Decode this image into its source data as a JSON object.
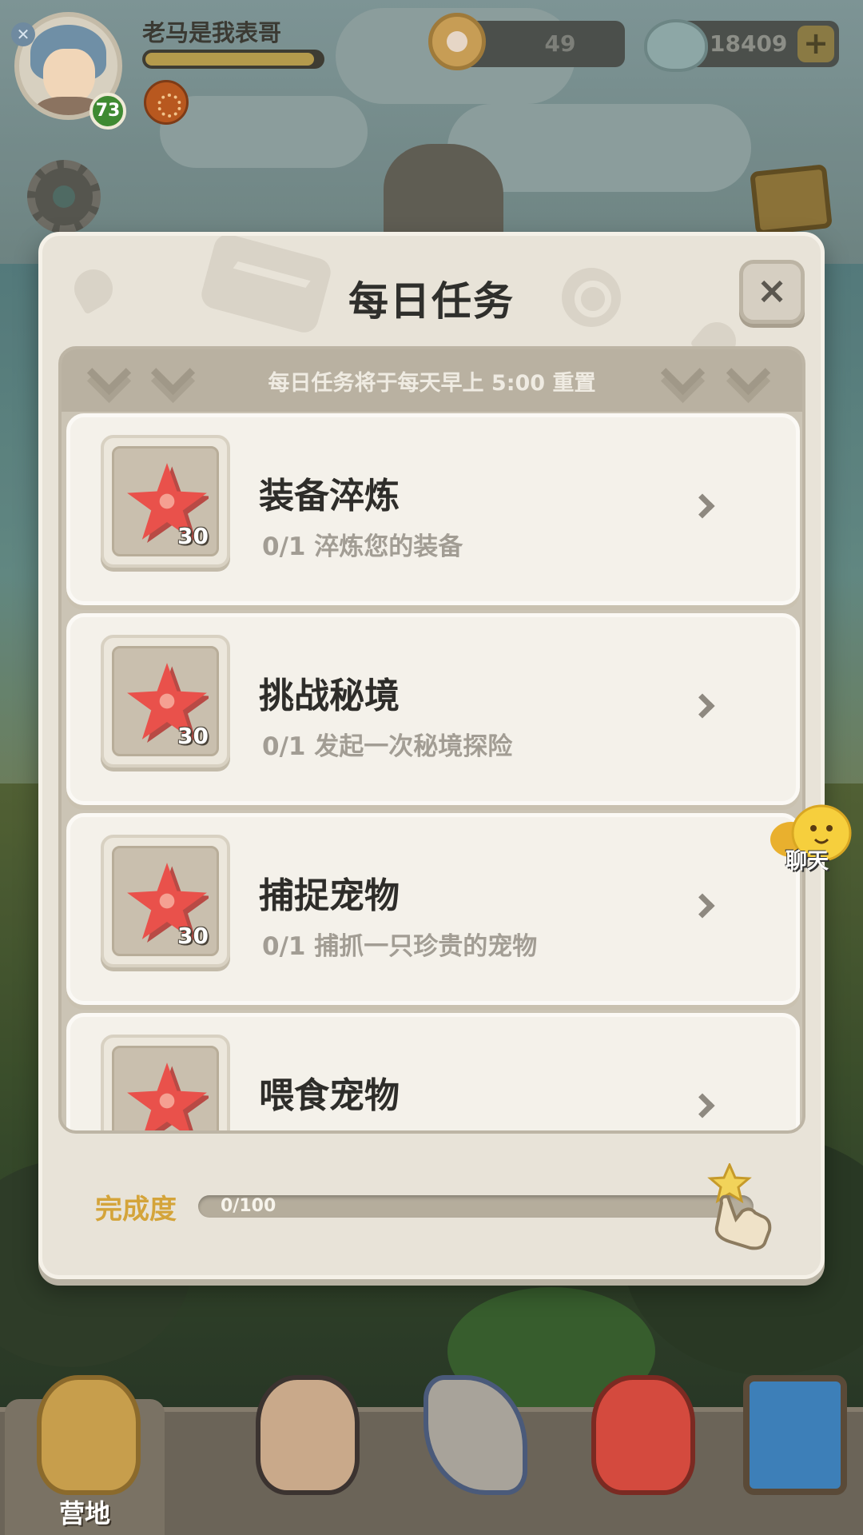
{
  "player": {
    "name": "老马是我表哥",
    "level": "73",
    "xp_fraction": 0.96
  },
  "currencies": {
    "pearl": "49",
    "shell": "18409",
    "plus_label": "+"
  },
  "modal": {
    "title": "每日任务",
    "close_label": "×",
    "reset_note": "每日任务将于每天早上 5:00 重置",
    "tasks": [
      {
        "name": "装备淬炼",
        "progress": "0/1",
        "desc": "淬炼您的装备",
        "reward_qty": "30",
        "reward_icon": "starfish-icon"
      },
      {
        "name": "挑战秘境",
        "progress": "0/1",
        "desc": "发起一次秘境探险",
        "reward_qty": "30",
        "reward_icon": "starfish-icon"
      },
      {
        "name": "捕捉宠物",
        "progress": "0/1",
        "desc": "捕抓一只珍贵的宠物",
        "reward_qty": "30",
        "reward_icon": "starfish-icon"
      },
      {
        "name": "喂食宠物",
        "progress": "",
        "desc": "",
        "reward_qty": "",
        "reward_icon": "starfish-icon"
      }
    ],
    "completion_label": "完成度",
    "completion_text": "0/100",
    "completion_fraction": 0
  },
  "chat": {
    "label": "聊天"
  },
  "nav": {
    "tabs": [
      {
        "label": "营地",
        "icon": "camp-icon",
        "active": true
      },
      {
        "label": "",
        "icon": "hero-icon"
      },
      {
        "label": "",
        "icon": "equipment-icon"
      },
      {
        "label": "",
        "icon": "pet-icon"
      },
      {
        "label": "",
        "icon": "portal-icon"
      }
    ]
  },
  "colors": {
    "accent_gold": "#d4a43a",
    "starfish": "#e9514b",
    "level_badge": "#3f8a32"
  }
}
